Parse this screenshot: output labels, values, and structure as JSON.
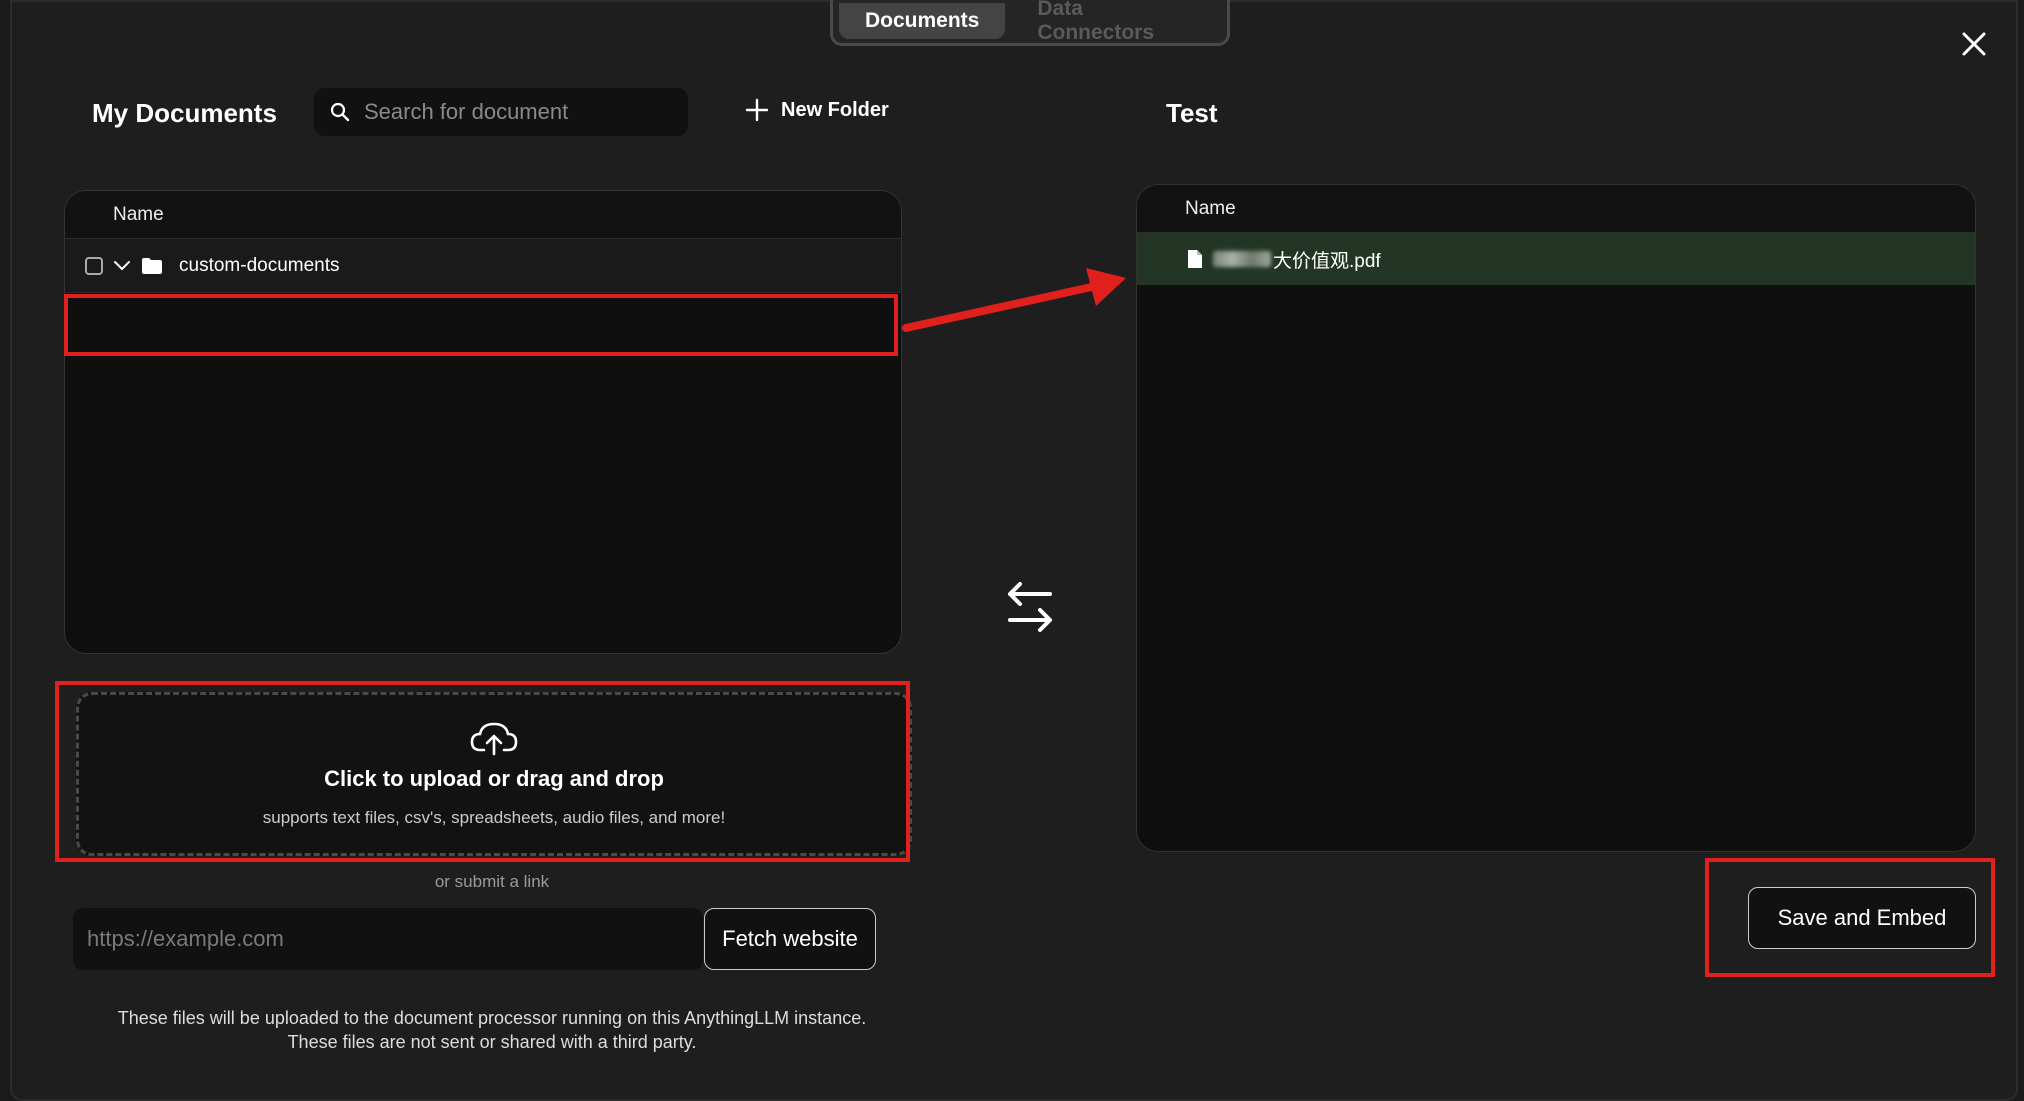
{
  "tabs": [
    {
      "label": "Documents",
      "active": true
    },
    {
      "label": "Data Connectors",
      "active": false
    }
  ],
  "left": {
    "title": "My Documents",
    "search_placeholder": "Search for document",
    "new_folder_label": "New Folder",
    "table_header": "Name",
    "folder_name": "custom-documents"
  },
  "right": {
    "title": "Test",
    "table_header": "Name",
    "file_name": "大价值观.pdf",
    "save_button": "Save and Embed"
  },
  "upload": {
    "main_text": "Click to upload or drag and drop",
    "sub_text": "supports text files, csv's, spreadsheets, audio files, and more!",
    "or_text": "or submit a link",
    "url_placeholder": "https://example.com",
    "fetch_button": "Fetch website",
    "footnote_line1": "These files will be uploaded to the document processor running on this AnythingLLM instance.",
    "footnote_line2": "These files are not sent or shared with a third party."
  },
  "colors": {
    "annotation": "#e0201c",
    "selected_row": "#233524"
  }
}
